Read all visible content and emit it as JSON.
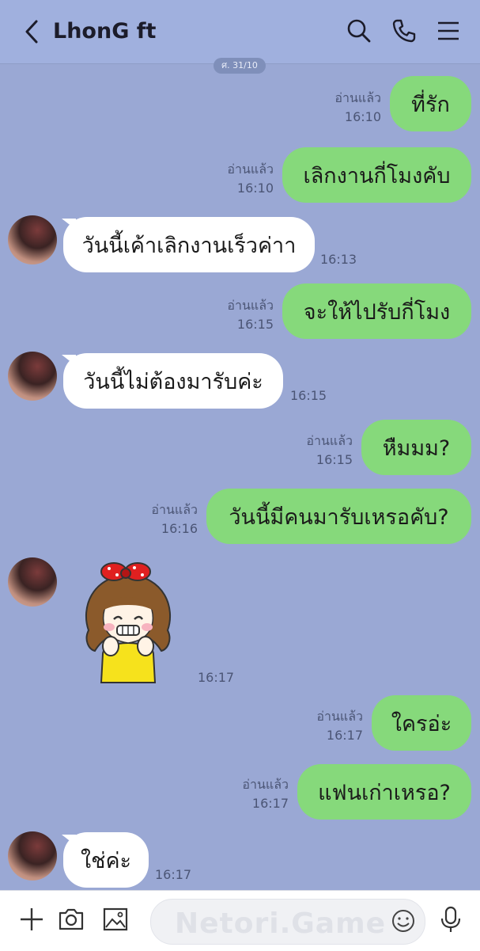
{
  "header": {
    "title": "LhonG ft",
    "date_label": "ศ. 31/10"
  },
  "messages": [
    {
      "text": "ที่รัก",
      "read": "อ่านแล้ว",
      "time": "16:10"
    },
    {
      "text": "เลิกงานกี่โมงคับ",
      "read": "อ่านแล้ว",
      "time": "16:10"
    },
    {
      "text": "วันนี้เค้าเลิกงานเร็วค่าา",
      "time": "16:13"
    },
    {
      "text": "จะให้ไปรับกี่โมง",
      "read": "อ่านแล้ว",
      "time": "16:15"
    },
    {
      "text": "วันนี้ไม่ต้องมารับค่ะ",
      "time": "16:15"
    },
    {
      "text": "หืมมม?",
      "read": "อ่านแล้ว",
      "time": "16:15"
    },
    {
      "text": "วันนี้มีคนมารับเหรอคับ?",
      "read": "อ่านแล้ว",
      "time": "16:16"
    },
    {
      "time": "16:17"
    },
    {
      "text": "ใครอ่ะ",
      "read": "อ่านแล้ว",
      "time": "16:17"
    },
    {
      "text": "แฟนเก่าเหรอ?",
      "read": "อ่านแล้ว",
      "time": "16:17"
    },
    {
      "text": "ใช่ค่ะ",
      "time": "16:17"
    }
  ],
  "footer": {
    "watermark": "Netori.Game",
    "input_placeholder": ""
  },
  "icons": {
    "back": "chevron-left-icon",
    "search": "search-icon",
    "call": "phone-icon",
    "menu": "menu-icon",
    "plus": "plus-icon",
    "camera": "camera-icon",
    "image": "image-icon",
    "emoji": "emoji-icon",
    "mic": "microphone-icon"
  }
}
